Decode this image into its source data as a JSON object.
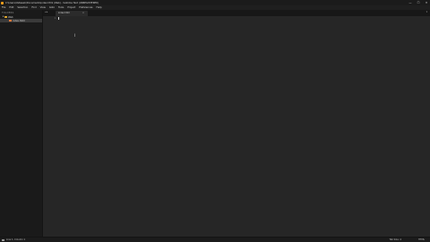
{
  "window": {
    "title": "C:\\Users\\Ustaweb\\Documents\\index.html (Web) - Sublime Text (UNREGISTERED)",
    "min": "—",
    "max": "☐",
    "close": "✕"
  },
  "menu": {
    "items": [
      "File",
      "Edit",
      "Selection",
      "Find",
      "View",
      "Goto",
      "Tools",
      "Project",
      "Preferences",
      "Help"
    ]
  },
  "sidebar": {
    "header": "FOLDERS",
    "folder": "Web",
    "file": "index.html"
  },
  "tabbar": {
    "nav": "◂ ▸",
    "menu": "▾"
  },
  "tabs": [
    {
      "label": "index.html",
      "close": "×"
    }
  ],
  "editor": {
    "line_number": "1"
  },
  "status": {
    "position": "Line 1, Column 1",
    "tab_size": "Tab Size: 4",
    "syntax": "HTML"
  },
  "colors": {
    "accent_folder": "#d8a431",
    "accent_file": "#e3793a",
    "editor_bg": "#262626"
  }
}
